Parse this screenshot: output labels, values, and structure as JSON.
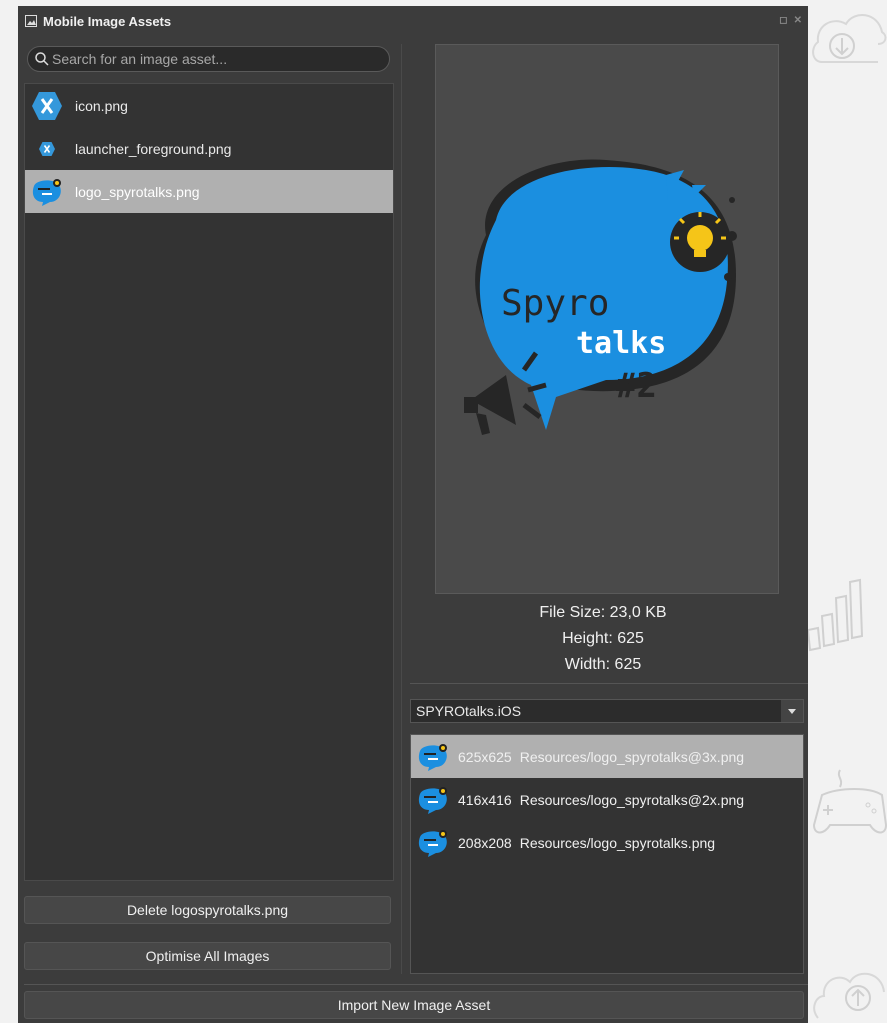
{
  "window": {
    "title": "Mobile Image Assets"
  },
  "search": {
    "placeholder": "Search for an image asset..."
  },
  "files": [
    {
      "label": "icon.png",
      "icon": "xamarin-icon",
      "selected": false
    },
    {
      "label": "launcher_foreground.png",
      "icon": "xamarin-small-icon",
      "selected": false
    },
    {
      "label": "logo_spyrotalks.png",
      "icon": "spyrotalks-logo-icon",
      "selected": true
    }
  ],
  "buttons": {
    "delete": "Delete logospyrotalks.png",
    "optimise": "Optimise All Images",
    "import": "Import New Image Asset"
  },
  "preview": {
    "logo_text": {
      "line1": "Spyro",
      "line2": "talks",
      "line3": "#2"
    }
  },
  "info": {
    "file_size": "File Size: 23,0 KB",
    "height": "Height: 625",
    "width": "Width:  625"
  },
  "project": {
    "selected": "SPYROtalks.iOS"
  },
  "variants": [
    {
      "size": "625x625",
      "path": "Resources/logo_spyrotalks@3x.png",
      "selected": true
    },
    {
      "size": "416x416",
      "path": "Resources/logo_spyrotalks@2x.png",
      "selected": false
    },
    {
      "size": "208x208",
      "path": "Resources/logo_spyrotalks.png",
      "selected": false
    }
  ],
  "colors": {
    "accent": "#1b8fe0",
    "panel": "#3c3c3c",
    "selection": "#b0b0b0"
  }
}
